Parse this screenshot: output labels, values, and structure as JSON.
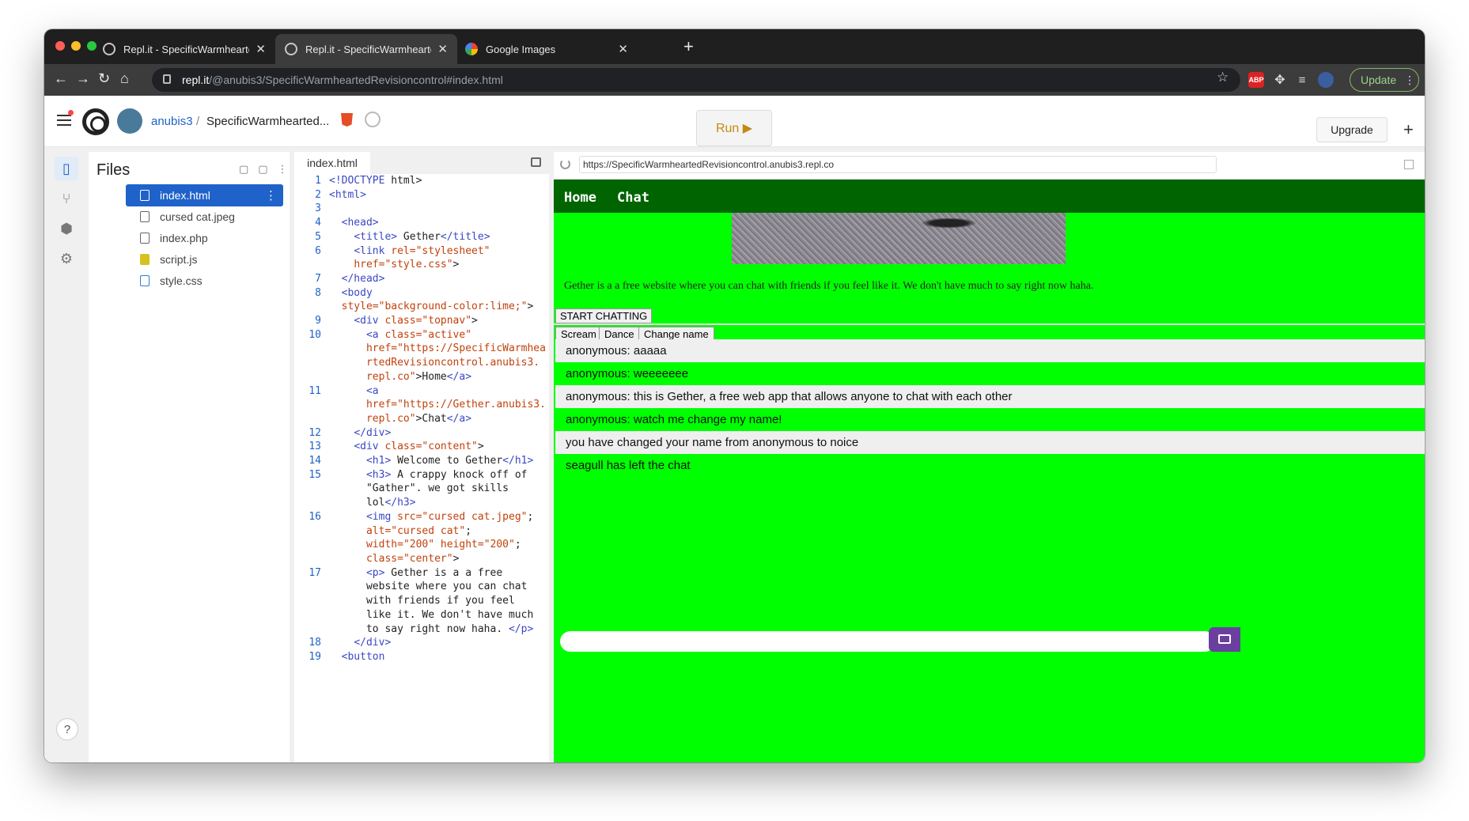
{
  "browser": {
    "tabs": [
      {
        "title": "Repl.it - SpecificWarmhearted",
        "active": false
      },
      {
        "title": "Repl.it - SpecificWarmhearted",
        "active": true
      },
      {
        "title": "Google Images",
        "active": false
      }
    ],
    "url_host": "repl.it",
    "url_path": "/@anubis3/SpecificWarmheartedRevisioncontrol#index.html",
    "update_label": "Update",
    "extensions": [
      "ABP"
    ]
  },
  "header": {
    "user": "anubis3",
    "separator": "/",
    "project": "SpecificWarmhearted...",
    "run_label": "Run ▶",
    "upgrade_label": "Upgrade",
    "plus": "+"
  },
  "files": {
    "title": "Files",
    "items": [
      {
        "name": "index.html",
        "selected": true
      },
      {
        "name": "cursed cat.jpeg",
        "selected": false
      },
      {
        "name": "index.php",
        "selected": false
      },
      {
        "name": "script.js",
        "selected": false
      },
      {
        "name": "style.css",
        "selected": false
      }
    ],
    "help": "?"
  },
  "editor": {
    "tab": "index.html"
  },
  "preview": {
    "url": "https://SpecificWarmheartedRevisioncontrol.anubis3.repl.co",
    "nav": [
      "Home",
      "Chat"
    ],
    "description": "Gether is a a free website where you can chat with friends if you feel like it. We don't have much to say right now haha.",
    "start_button": "START CHATTING",
    "actions": [
      "Scream",
      "Dance",
      "Change name"
    ],
    "messages": [
      "anonymous: aaaaa",
      "anonymous: weeeeeee",
      "anonymous: this is Gether, a free web app that allows anyone to chat with each other",
      "anonymous: watch me change my name!",
      "you have changed your name from anonymous to noice",
      "seagull has left the chat"
    ]
  },
  "colors": {
    "site_bg": "#00ff00",
    "topnav_bg": "#006400",
    "selected_file": "#1f62c9",
    "run_label": "#c28a10"
  }
}
